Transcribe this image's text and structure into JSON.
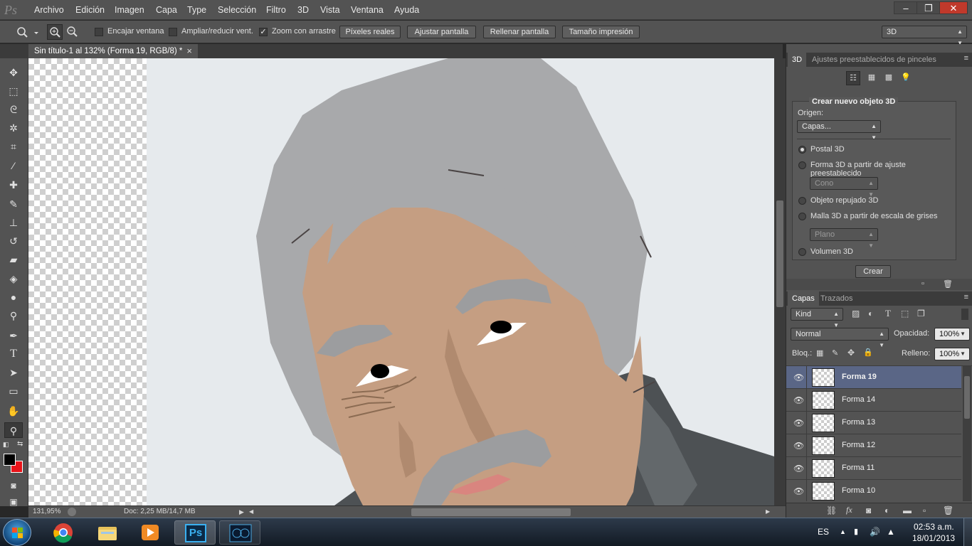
{
  "app": {
    "logo": "Ps"
  },
  "menubar": {
    "items": [
      "Archivo",
      "Edición",
      "Imagen",
      "Capa",
      "Type",
      "Selección",
      "Filtro",
      "3D",
      "Vista",
      "Ventana",
      "Ayuda"
    ],
    "window_controls": [
      "‒",
      "❐",
      "✕"
    ]
  },
  "options_bar": {
    "tool_icon": "zoom-icon",
    "checks": [
      {
        "label": "Encajar ventana",
        "checked": false
      },
      {
        "label": "Ampliar/reducir vent.",
        "checked": false
      },
      {
        "label": "Zoom con arrastre",
        "checked": true
      }
    ],
    "buttons": [
      "Píxeles reales",
      "Ajustar pantalla",
      "Rellenar pantalla",
      "Tamaño impresión"
    ],
    "workspace": "3D"
  },
  "document_tab": {
    "title": "Sin título-1 al 132% (Forma 19, RGB/8) *",
    "close": "×"
  },
  "toolbox": {
    "tools": [
      "move-icon",
      "marquee-icon",
      "lasso-icon",
      "magic-wand-icon",
      "crop-icon",
      "eyedropper-icon",
      "healing-icon",
      "brush-icon",
      "stamp-icon",
      "history-brush-icon",
      "eraser-icon",
      "paint-bucket-icon",
      "blur-icon",
      "dodge-icon",
      "pen-icon",
      "type-icon",
      "path-select-icon",
      "rectangle-icon",
      "hand-icon",
      "zoom-icon"
    ],
    "foreground_color": "#000000",
    "background_color": "#e8141a"
  },
  "status_bar": {
    "zoom": "131,95%",
    "doc": "Doc: 2,25 MB/14,7 MB"
  },
  "panel_3d": {
    "tabs": [
      "3D",
      "Ajustes preestablecidos de pinceles"
    ],
    "section_title": "Crear nuevo objeto 3D",
    "origin_label": "Origen:",
    "origin_value": "Capas...",
    "options": [
      {
        "label": "Postal 3D",
        "selected": true
      },
      {
        "label": "Forma 3D a partir de ajuste preestablecido",
        "selected": false
      },
      {
        "label": "Objeto repujado 3D",
        "selected": false
      },
      {
        "label": "Malla 3D a partir de escala de grises",
        "selected": false
      },
      {
        "label": "Volumen 3D",
        "selected": false
      }
    ],
    "shape_preset": "Cono",
    "mesh_preset": "Plano",
    "create_button": "Crear"
  },
  "layers_panel": {
    "tabs": [
      "Capas",
      "Trazados"
    ],
    "filter_kind": "Kind",
    "blend_mode": "Normal",
    "opacity_label": "Opacidad:",
    "opacity_value": "100%",
    "lock_label": "Bloq.:",
    "fill_label": "Relleno:",
    "fill_value": "100%",
    "layers": [
      {
        "name": "Forma 19",
        "selected": true
      },
      {
        "name": "Forma 14",
        "selected": false
      },
      {
        "name": "Forma 13",
        "selected": false
      },
      {
        "name": "Forma 12",
        "selected": false
      },
      {
        "name": "Forma 11",
        "selected": false
      },
      {
        "name": "Forma 10",
        "selected": false
      }
    ]
  },
  "taskbar": {
    "language": "ES",
    "time": "02:53 a.m.",
    "date": "18/01/2013",
    "apps": [
      "chrome-icon",
      "file-explorer-icon",
      "media-player-icon",
      "photoshop-icon",
      "virtualdj-icon"
    ],
    "photoshop_label": "Ps"
  },
  "colors": {
    "skin": "#c59e82",
    "hair": "#a8a9ab",
    "eyebrow": "#9c9d9f",
    "background": "#e6eaed",
    "lips": "#d9857f",
    "jacket": "#4d5154"
  }
}
